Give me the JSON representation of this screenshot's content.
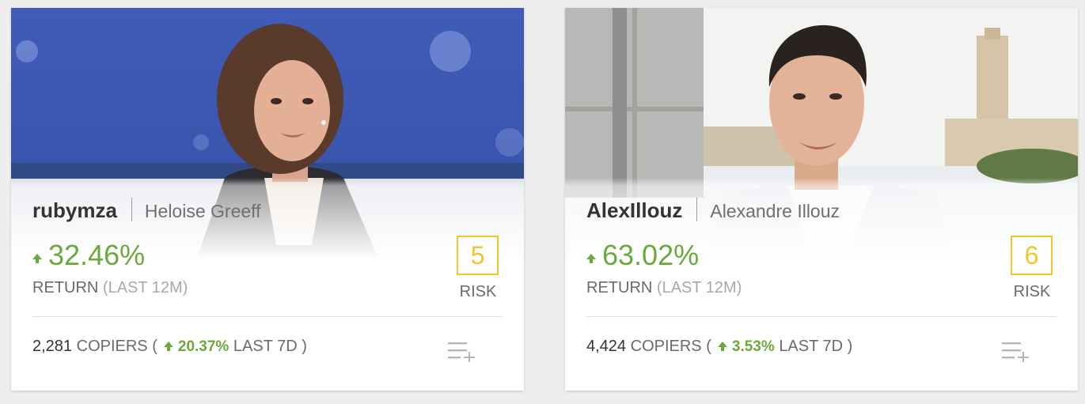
{
  "cards": [
    {
      "username": "rubymza",
      "real_name": "Heloise Greeff",
      "return_value": "32.46%",
      "return_label": "RETURN",
      "return_period": "(LAST 12M)",
      "risk_score": "5",
      "risk_label": "RISK",
      "copiers_count": "2,281",
      "copiers_label": "COPIERS (",
      "copiers_change": "20.37%",
      "copiers_period": "LAST 7D )",
      "photo_icon": "trader-photo",
      "action_icon": "add-to-watchlist-icon"
    },
    {
      "username": "AlexIllouz",
      "real_name": "Alexandre Illouz",
      "return_value": "63.02%",
      "return_label": "RETURN",
      "return_period": "(LAST 12M)",
      "risk_score": "6",
      "risk_label": "RISK",
      "copiers_count": "4,424",
      "copiers_label": "COPIERS (",
      "copiers_change": "3.53%",
      "copiers_period": "LAST 7D )",
      "photo_icon": "trader-photo",
      "action_icon": "add-to-watchlist-icon"
    }
  ],
  "colors": {
    "positive": "#6aa93a",
    "risk": "#f0c52f",
    "text_dark": "#333333",
    "text_muted": "#a8a8a8"
  }
}
